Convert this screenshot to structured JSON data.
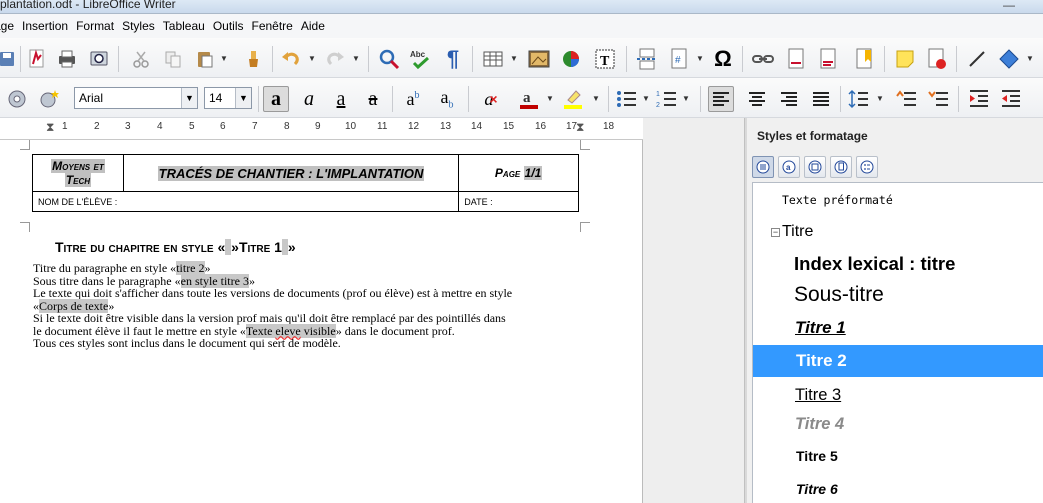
{
  "window": {
    "title": "plantation.odt - LibreOffice Writer",
    "minimize_glyph": "—"
  },
  "menu": [
    "age",
    "Insertion",
    "Format",
    "Styles",
    "Tableau",
    "Outils",
    "Fenêtre",
    "Aide"
  ],
  "format_bar": {
    "font_name": "Arial",
    "font_size": "14"
  },
  "ruler": {
    "labels": [
      "1",
      "2",
      "3",
      "4",
      "5",
      "6",
      "7",
      "8",
      "9",
      "10",
      "11",
      "12",
      "13",
      "14",
      "15",
      "16",
      "17",
      "18"
    ]
  },
  "document": {
    "header": {
      "left_line1": "Moyens et",
      "left_line2": "Tech",
      "center": "TRACÉS DE CHANTIER : L'IMPLANTATION",
      "right_prefix": "Page ",
      "right_page": "1/1",
      "name_label": "NOM DE L'ÉLÈVE :",
      "date_label": "DATE :"
    },
    "chapter_title": {
      "text": "Titre du chapitre en style ",
      "open_quote": "«",
      "quote_close_open": "»",
      "marked": "Titre 1",
      "end_quote": "»"
    },
    "lines": {
      "l1_pre": "Titre du paragraphe en style «",
      "l1_mark": "titre 2",
      "l1_post": "»",
      "l2_pre": "Sous titre dans le paragraphe «",
      "l2_mark": "en style titre 3",
      "l2_post": "»",
      "l3": "Le texte qui doit s'afficher dans toute les versions de documents (prof ou élève) est à mettre en style",
      "l4_pre": "«",
      "l4_mark": "Corps de texte",
      "l4_post": "»",
      "l5": "Si le texte doit être visible dans la version prof mais qu'il doit être remplacé par des pointillés dans",
      "l6_pre": "le document élève il faut le mettre en style «",
      "l6_mark_a": "Texte ",
      "l6_mark_b": "eleve",
      "l6_mark_c": " visible",
      "l6_post": "» dans le document prof.",
      "l7": "Tous ces styles sont inclus dans le document qui sert de modèle."
    }
  },
  "styles_panel": {
    "title": "Styles et formatage",
    "items": [
      {
        "label": "Texte préformaté"
      },
      {
        "label": "Titre"
      },
      {
        "label": "Index lexical : titre"
      },
      {
        "label": "Sous-titre"
      },
      {
        "label": "Titre 1"
      },
      {
        "label": "Titre 2"
      },
      {
        "label": "Titre 3"
      },
      {
        "label": "Titre 4"
      },
      {
        "label": "Titre 5"
      },
      {
        "label": "Titre 6"
      }
    ],
    "collapse_glyph": "−"
  },
  "colors": {
    "selection": "#3399ff",
    "font_color_bar": "#c00000",
    "highlight_bar": "#ffff00",
    "spell_squiggle": "#ee3333"
  }
}
